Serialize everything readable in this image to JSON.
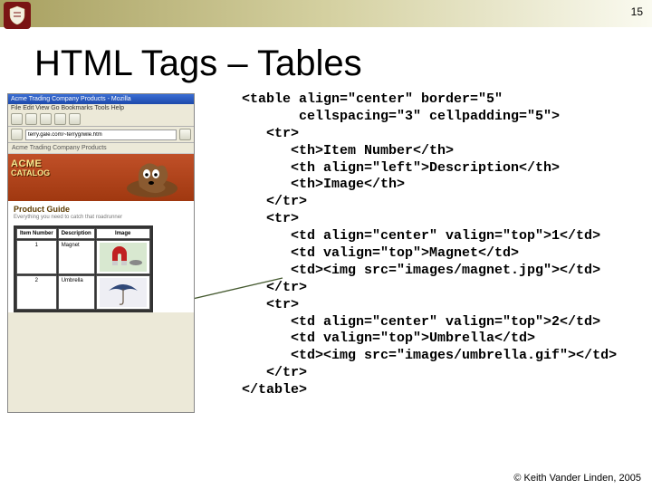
{
  "page_number": "15",
  "title": "HTML Tags – Tables",
  "browser": {
    "titlebar": "Acme Trading Company Products - Mozilla",
    "menubar": "File  Edit  View  Go  Bookmarks  Tools  Help",
    "address": "terry.gale.com/~terryg/wile.htm",
    "tab": "Acme Trading Company Products",
    "banner_line1": "ACME",
    "banner_line2": "CATALOG",
    "page_heading": "Product Guide",
    "tagline": "Everything you need to catch that roadrunner",
    "table": {
      "headers": [
        "Item Number",
        "Description",
        "Image"
      ],
      "rows": [
        {
          "num": "1",
          "desc": "Magnet"
        },
        {
          "num": "2",
          "desc": "Umbrella"
        }
      ]
    }
  },
  "code": "<table align=\"center\" border=\"5\"\n       cellspacing=\"3\" cellpadding=\"5\">\n   <tr>\n      <th>Item Number</th>\n      <th align=\"left\">Description</th>\n      <th>Image</th>\n   </tr>\n   <tr>\n      <td align=\"center\" valign=\"top\">1</td>\n      <td valign=\"top\">Magnet</td>\n      <td><img src=\"images/magnet.jpg\"></td>\n   </tr>\n   <tr>\n      <td align=\"center\" valign=\"top\">2</td>\n      <td valign=\"top\">Umbrella</td>\n      <td><img src=\"images/umbrella.gif\"></td>\n   </tr>\n</table>",
  "footer": "© Keith Vander Linden, 2005"
}
